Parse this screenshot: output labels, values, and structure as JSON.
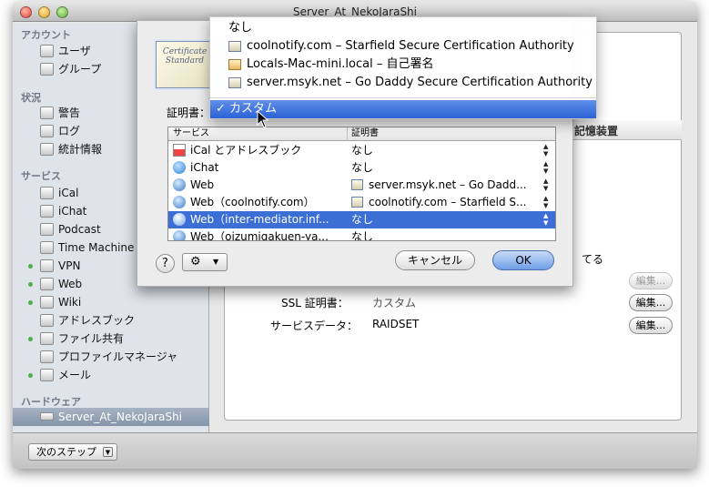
{
  "window": {
    "title": "Server_At_NekoJaraShi"
  },
  "sidebar": {
    "sections": [
      {
        "label": "アカウント"
      },
      {
        "label": "状況"
      },
      {
        "label": "サービス"
      },
      {
        "label": "ハードウェア"
      }
    ],
    "accounts": [
      {
        "label": "ユーザ",
        "icon": "user-icon"
      },
      {
        "label": "グループ",
        "icon": "group-icon"
      }
    ],
    "status": [
      {
        "label": "警告",
        "icon": "alert-icon"
      },
      {
        "label": "ログ",
        "icon": "log-icon"
      },
      {
        "label": "統計情報",
        "icon": "stats-icon"
      }
    ],
    "services": [
      {
        "label": "iCal",
        "icon": "ical-icon",
        "running": false
      },
      {
        "label": "iChat",
        "icon": "ichat-icon",
        "running": false
      },
      {
        "label": "Podcast",
        "icon": "podcast-icon",
        "running": false
      },
      {
        "label": "Time Machine",
        "icon": "time-machine-icon",
        "running": false
      },
      {
        "label": "VPN",
        "icon": "vpn-icon",
        "running": true
      },
      {
        "label": "Web",
        "icon": "web-icon",
        "running": true
      },
      {
        "label": "Wiki",
        "icon": "wiki-icon",
        "running": true
      },
      {
        "label": "アドレスブック",
        "icon": "address-book-icon",
        "running": false
      },
      {
        "label": "ファイル共有",
        "icon": "file-sharing-icon",
        "running": true
      },
      {
        "label": "プロファイルマネージャ",
        "icon": "profile-manager-icon",
        "running": false
      },
      {
        "label": "メール",
        "icon": "mail-icon",
        "running": true
      }
    ],
    "hardware": [
      {
        "label": "Server_At_NekoJaraShi",
        "icon": "server-icon",
        "selected": true
      }
    ]
  },
  "bottombar": {
    "next_step_label": "次のステップ"
  },
  "main": {
    "column_header_right": "記憶装置",
    "ssl_label": "SSL 証明書：",
    "ssl_value": "カスタム",
    "service_data_label": "サービスデータ：",
    "service_data_value": "RAIDSET",
    "edit_label": "編集...",
    "checkbox_text_tail": "てる"
  },
  "sheet": {
    "cert_icon_text": "Certificate Standard",
    "cert_label": "証明書：",
    "table_headers": {
      "service": "サービス",
      "certificate": "証明書"
    },
    "rows": [
      {
        "service": "iCal とアドレスブック",
        "cert": "なし",
        "icon": "ical-icon",
        "cert_icon": false,
        "selected": false
      },
      {
        "service": "iChat",
        "cert": "なし",
        "icon": "ichat-icon",
        "cert_icon": false,
        "selected": false
      },
      {
        "service": "Web",
        "cert": "server.msyk.net – Go Dadd...",
        "icon": "globe-icon",
        "cert_icon": true,
        "selected": false
      },
      {
        "service": "Web（coolnotify.com）",
        "cert": "coolnotify.com – Starfield S...",
        "icon": "globe-icon",
        "cert_icon": true,
        "selected": false
      },
      {
        "service": "Web（inter-mediator.inf...",
        "cert": "なし",
        "icon": "globe-icon",
        "cert_icon": false,
        "selected": true
      },
      {
        "service": "Web（oizumigakuen-ya...",
        "cert": "なし",
        "icon": "globe-icon",
        "cert_icon": false,
        "selected": false
      }
    ],
    "help_label": "?",
    "cancel_label": "キャンセル",
    "ok_label": "OK"
  },
  "popup_menu": {
    "items": [
      {
        "label": "なし",
        "icon": false
      },
      {
        "label": "coolnotify.com – Starfield Secure Certification Authority",
        "icon": true
      },
      {
        "label": "Locals-Mac-mini.local – 自己署名",
        "icon": true
      },
      {
        "label": "server.msyk.net – Go Daddy Secure Certification Authority",
        "icon": true
      }
    ],
    "selected_label": "✓ カスタム"
  },
  "colors": {
    "selection": "#3b6fd5",
    "running_dot": "#4fb04a",
    "menu_highlight": "#2c62d6"
  }
}
